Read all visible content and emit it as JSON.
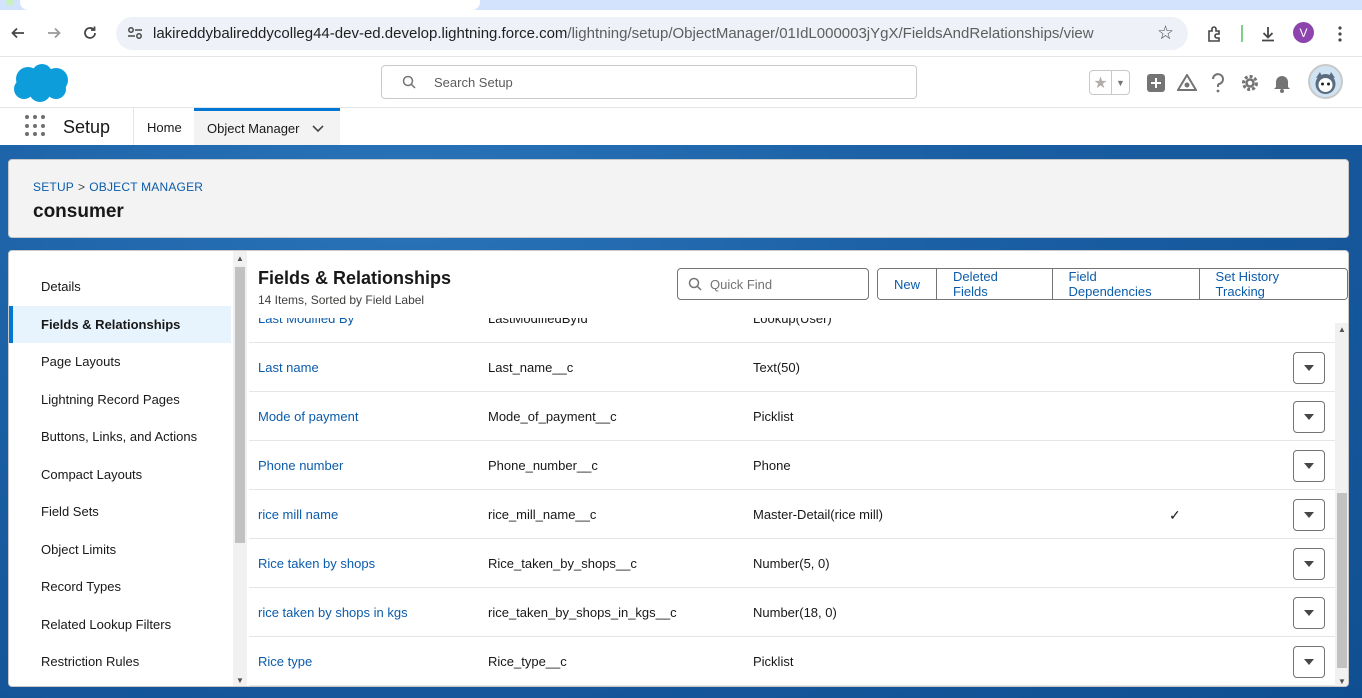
{
  "browser": {
    "url_host": "lakireddybalireddycolleg44-dev-ed.develop.lightning.force.com",
    "url_path": "/lightning/setup/ObjectManager/01IdL000003jYgX/FieldsAndRelationships/view",
    "profile_initial": "V"
  },
  "header": {
    "search_placeholder": "Search Setup"
  },
  "context_bar": {
    "app_name": "Setup",
    "tabs": [
      {
        "label": "Home"
      },
      {
        "label": "Object Manager"
      }
    ]
  },
  "object": {
    "breadcrumb": [
      "SETUP",
      "OBJECT MANAGER"
    ],
    "breadcrumb_sep": ">",
    "title": "consumer"
  },
  "leftnav": {
    "items": [
      {
        "label": "Details"
      },
      {
        "label": "Fields & Relationships"
      },
      {
        "label": "Page Layouts"
      },
      {
        "label": "Lightning Record Pages"
      },
      {
        "label": "Buttons, Links, and Actions"
      },
      {
        "label": "Compact Layouts"
      },
      {
        "label": "Field Sets"
      },
      {
        "label": "Object Limits"
      },
      {
        "label": "Record Types"
      },
      {
        "label": "Related Lookup Filters"
      },
      {
        "label": "Restriction Rules"
      }
    ],
    "active_index": 1
  },
  "panel": {
    "title": "Fields & Relationships",
    "subtitle": "14 Items, Sorted by Field Label",
    "quickfind_placeholder": "Quick Find",
    "buttons": [
      "New",
      "Deleted Fields",
      "Field Dependencies",
      "Set History Tracking"
    ]
  },
  "fields": [
    {
      "label": "Last Modified By",
      "api": "LastModifiedById",
      "type": "Lookup(User)",
      "indexed": false,
      "has_menu": false
    },
    {
      "label": "Last name",
      "api": "Last_name__c",
      "type": "Text(50)",
      "indexed": false,
      "has_menu": true
    },
    {
      "label": "Mode of payment",
      "api": "Mode_of_payment__c",
      "type": "Picklist",
      "indexed": false,
      "has_menu": true
    },
    {
      "label": "Phone number",
      "api": "Phone_number__c",
      "type": "Phone",
      "indexed": false,
      "has_menu": true
    },
    {
      "label": "rice mill name",
      "api": "rice_mill_name__c",
      "type": "Master-Detail(rice mill)",
      "indexed": true,
      "has_menu": true
    },
    {
      "label": "Rice taken by shops",
      "api": "Rice_taken_by_shops__c",
      "type": "Number(5, 0)",
      "indexed": false,
      "has_menu": true
    },
    {
      "label": "rice taken by shops in kgs",
      "api": "rice_taken_by_shops_in_kgs__c",
      "type": "Number(18, 0)",
      "indexed": false,
      "has_menu": true
    },
    {
      "label": "Rice type",
      "api": "Rice_type__c",
      "type": "Picklist",
      "indexed": false,
      "has_menu": true
    }
  ],
  "icons": {
    "checkmark": "✓"
  },
  "colors": {
    "brand": "#0176d3",
    "link": "#0b5cab",
    "page_bg": "#1b5fa4"
  }
}
